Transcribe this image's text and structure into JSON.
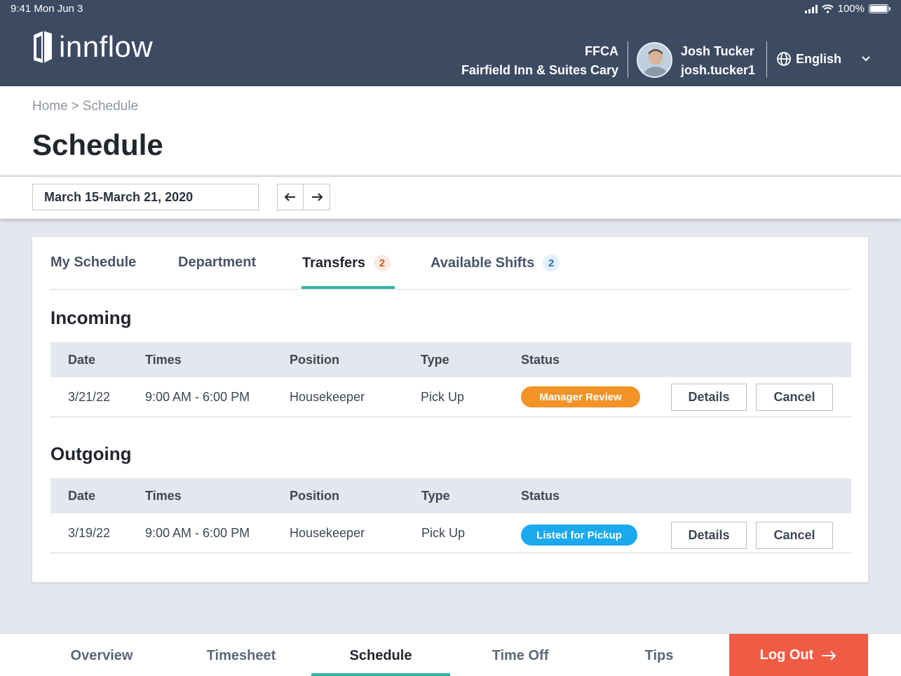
{
  "status_bar": {
    "time_date": "9:41  Mon Jun 3",
    "battery": "100%"
  },
  "header": {
    "brand": "innflow",
    "org_code": "FFCA",
    "org_name": "Fairfield Inn & Suites Cary",
    "user_name": "Josh Tucker",
    "user_id": "josh.tucker1",
    "language": "English"
  },
  "breadcrumb": {
    "home": "Home",
    "sep": ">",
    "current": "Schedule"
  },
  "page_title": "Schedule",
  "date_range": "March 15-March 21, 2020",
  "tabs": [
    {
      "label": "My Schedule"
    },
    {
      "label": "Department"
    },
    {
      "label": "Transfers",
      "count": "2"
    },
    {
      "label": "Available Shifts",
      "count": "2"
    }
  ],
  "columns": {
    "date": "Date",
    "times": "Times",
    "position": "Position",
    "type": "Type",
    "status": "Status"
  },
  "incoming": {
    "title": "Incoming",
    "row": {
      "date": "3/21/22",
      "times": "9:00 AM - 6:00 PM",
      "position": "Housekeeper",
      "type": "Pick Up",
      "status": "Manager Review",
      "details": "Details",
      "cancel": "Cancel"
    }
  },
  "outgoing": {
    "title": "Outgoing",
    "row": {
      "date": "3/19/22",
      "times": "9:00 AM - 6:00 PM",
      "position": "Housekeeper",
      "type": "Pick Up",
      "status": "Listed for Pickup",
      "details": "Details",
      "cancel": "Cancel"
    }
  },
  "bottom_nav": {
    "overview": "Overview",
    "timesheet": "Timesheet",
    "schedule": "Schedule",
    "time_off": "Time Off",
    "tips": "Tips",
    "logout": "Log Out"
  },
  "colors": {
    "header_bg": "#3c4a62",
    "accent_teal": "#2fb5a5",
    "logout_red": "#ef5b45",
    "pill_orange": "#f39226",
    "pill_blue": "#1aa9ee"
  },
  "icons": [
    "cellular-signal-icon",
    "wifi-icon",
    "battery-icon",
    "innflow-logo-icon",
    "avatar",
    "globe-icon",
    "chevron-down-icon",
    "arrow-left-icon",
    "arrow-right-icon",
    "arrow-right-logout-icon"
  ]
}
